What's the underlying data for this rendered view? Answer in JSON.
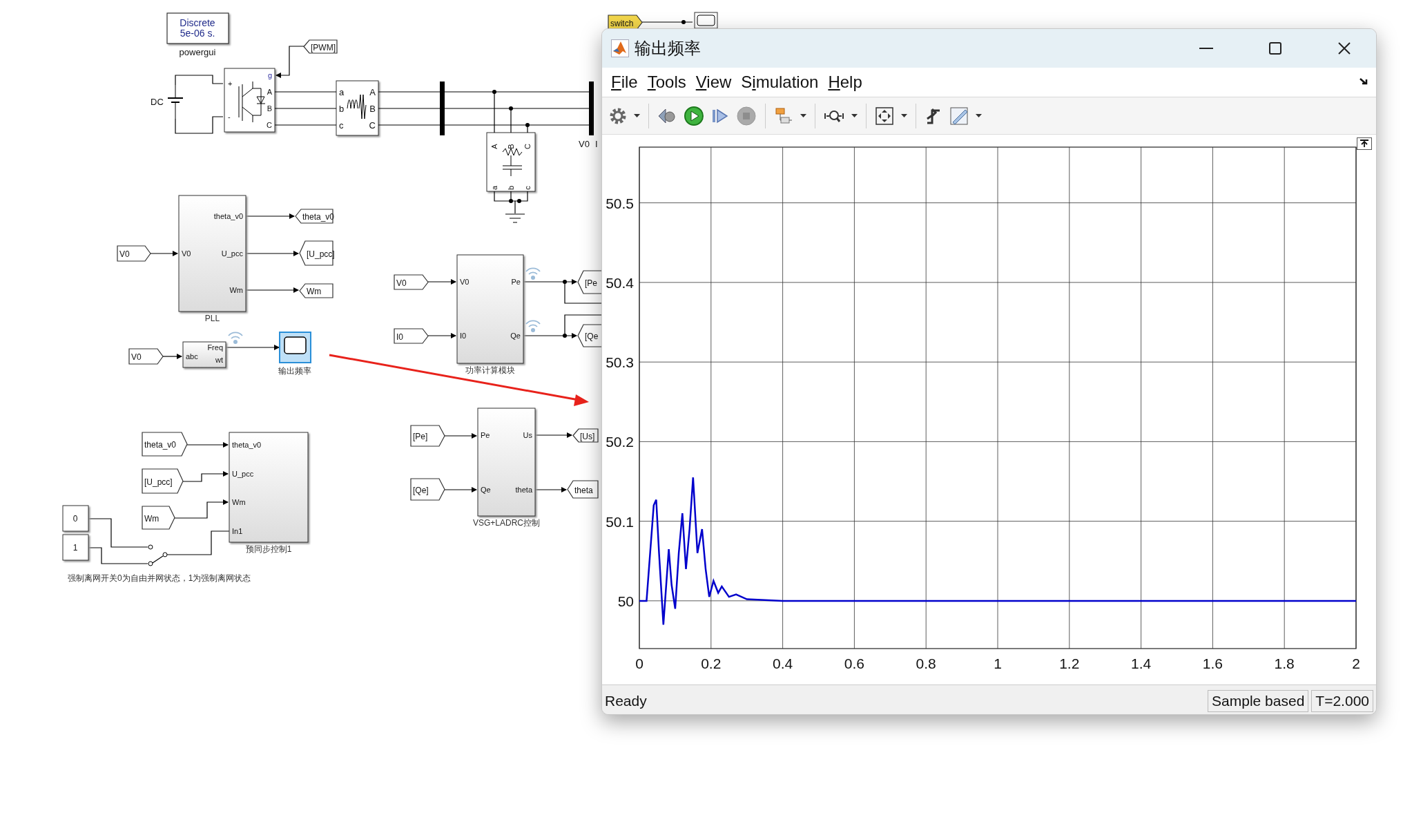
{
  "diagram": {
    "powergui": {
      "lines": [
        "Discrete",
        "5e-06 s."
      ],
      "caption": "powergui"
    },
    "dc_label": "DC",
    "inverter_ports": [
      "+",
      "-",
      "g",
      "A",
      "B",
      "C"
    ],
    "filter_ports": [
      "a",
      "b",
      "c",
      "A",
      "B",
      "C"
    ],
    "load_ports": [
      "A",
      "B",
      "C",
      "a",
      "b",
      "c"
    ],
    "bus_labels": [
      "V0",
      "I"
    ],
    "tags": [
      {
        "text": "[PWM]",
        "kind": "goto",
        "highlighted": false
      },
      {
        "text": "theta_v0",
        "kind": "goto",
        "highlighted": false
      },
      {
        "text": "[U_pcc]",
        "kind": "goto",
        "highlighted": false
      },
      {
        "text": "Wm",
        "kind": "goto",
        "highlighted": false
      },
      {
        "text": "V0",
        "kind": "from",
        "highlighted": false
      },
      {
        "text": "V0",
        "kind": "from",
        "highlighted": false
      },
      {
        "text": "V0",
        "kind": "from",
        "highlighted": false
      },
      {
        "text": "I0",
        "kind": "from",
        "highlighted": false
      },
      {
        "text": "[Pe",
        "kind": "goto",
        "highlighted": false
      },
      {
        "text": "[Qe",
        "kind": "goto",
        "highlighted": false
      },
      {
        "text": "theta_v0",
        "kind": "from",
        "highlighted": false
      },
      {
        "text": "[U_pcc]",
        "kind": "from",
        "highlighted": false
      },
      {
        "text": "Wm",
        "kind": "from",
        "highlighted": false
      },
      {
        "text": "[Pe]",
        "kind": "from",
        "highlighted": false
      },
      {
        "text": "[Qe]",
        "kind": "from",
        "highlighted": false
      },
      {
        "text": "[Us]",
        "kind": "goto",
        "highlighted": false
      },
      {
        "text": "theta",
        "kind": "goto",
        "highlighted": false
      },
      {
        "text": "switch",
        "kind": "from",
        "highlighted": true
      }
    ],
    "blocks": [
      {
        "caption": "PLL",
        "inputs": [
          "V0"
        ],
        "outputs": [
          "theta_v0",
          "U_pcc",
          "Wm"
        ]
      },
      {
        "inputs": [
          "abc"
        ],
        "outputs": [
          "Freq",
          "wt"
        ]
      },
      {
        "caption": "功率计算模块",
        "inputs": [
          "V0",
          "I0"
        ],
        "outputs": [
          "Pe",
          "Qe"
        ]
      },
      {
        "caption": "预同步控制1",
        "inputs": [
          "theta_v0",
          "U_pcc",
          "Wm",
          "In1"
        ]
      },
      {
        "caption": "VSG+LADRC控制",
        "inputs": [
          "Pe",
          "Qe"
        ],
        "outputs": [
          "Us",
          "theta"
        ]
      }
    ],
    "constants": [
      "0",
      "1"
    ],
    "scope": {
      "caption": "输出频率",
      "selected": true
    },
    "note": "强制离网开关0为自由并网状态，1为强制离网状态"
  },
  "scope_window": {
    "title": "输出频率",
    "menu": [
      {
        "key": "F",
        "rest": "ile"
      },
      {
        "key": "T",
        "rest": "ools"
      },
      {
        "key": "V",
        "rest": "iew"
      },
      {
        "pre": "S",
        "key": "i",
        "rest": "mulation"
      },
      {
        "key": "H",
        "rest": "elp"
      }
    ],
    "chart_data": {
      "type": "line",
      "grid": true,
      "xlim": [
        0,
        2
      ],
      "ylim": [
        49.94,
        50.57
      ],
      "xticks": [
        0,
        0.2,
        0.4,
        0.6,
        0.8,
        1,
        1.2,
        1.4,
        1.6,
        1.8,
        2
      ],
      "yticks": [
        50,
        50.1,
        50.2,
        50.3,
        50.4,
        50.5
      ],
      "x": [
        0,
        0.02,
        0.03,
        0.04,
        0.047,
        0.055,
        0.067,
        0.075,
        0.082,
        0.09,
        0.1,
        0.11,
        0.12,
        0.13,
        0.14,
        0.15,
        0.162,
        0.175,
        0.185,
        0.195,
        0.207,
        0.22,
        0.23,
        0.25,
        0.27,
        0.3,
        0.4,
        2
      ],
      "series": [
        {
          "color": "#0000cc",
          "values": [
            50,
            50,
            50.06,
            50.12,
            50.127,
            50.06,
            49.97,
            50.02,
            50.065,
            50.02,
            49.99,
            50.06,
            50.11,
            50.04,
            50.09,
            50.155,
            50.06,
            50.09,
            50.04,
            50.005,
            50.025,
            50.01,
            50.018,
            50.005,
            50.008,
            50.002,
            50,
            50
          ]
        }
      ]
    },
    "status_bar": {
      "status": "Ready",
      "mode": "Sample based",
      "time": "T=2.000"
    }
  }
}
